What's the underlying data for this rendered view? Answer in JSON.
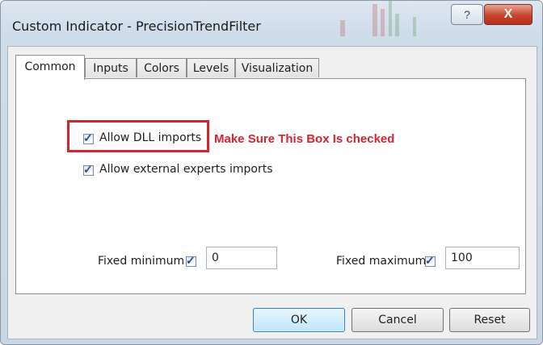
{
  "window": {
    "title": "Custom Indicator - PrecisionTrendFilter",
    "help_label": "?",
    "close_label": "X"
  },
  "tabs": [
    {
      "label": "Common",
      "active": true
    },
    {
      "label": "Inputs",
      "active": false
    },
    {
      "label": "Colors",
      "active": false
    },
    {
      "label": "Levels",
      "active": false
    },
    {
      "label": "Visualization",
      "active": false
    }
  ],
  "common": {
    "allow_dll": {
      "label": "Allow DLL imports",
      "checked": true
    },
    "allow_external": {
      "label": "Allow external experts imports",
      "checked": true
    },
    "annotation": "Make Sure This Box Is checked",
    "fixed_minimum": {
      "label": "Fixed minimum",
      "checked": true,
      "value": "0"
    },
    "fixed_maximum": {
      "label": "Fixed maximum",
      "checked": true,
      "value": "100"
    }
  },
  "buttons": {
    "ok": "OK",
    "cancel": "Cancel",
    "reset": "Reset"
  },
  "colors": {
    "annotation": "#d8242c",
    "check": "#2a4f8a"
  }
}
